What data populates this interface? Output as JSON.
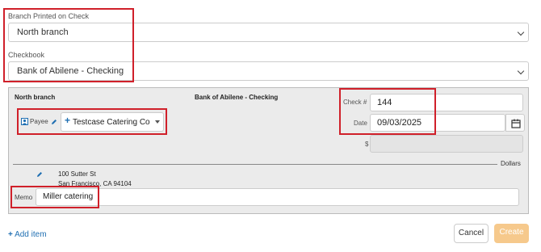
{
  "branch": {
    "label": "Branch Printed on Check",
    "value": "North branch"
  },
  "checkbook": {
    "label": "Checkbook",
    "value": "Bank of Abilene - Checking"
  },
  "check": {
    "branch_name": "North branch",
    "bank_name": "Bank of Abilene - Checking",
    "check_no_label": "Check #",
    "check_no": "144",
    "date_label": "Date",
    "date": "09/03/2025",
    "amount_symbol": "$",
    "amount": "",
    "payee_label": "Payee",
    "payee_value": "Testcase Catering Co",
    "dollars_label": "Dollars",
    "address_line1": "100 Sutter St",
    "address_line2": "San Francisco, CA 94104",
    "memo_label": "Memo",
    "memo_value": "Miller catering"
  },
  "actions": {
    "add_item": "Add item",
    "cancel": "Cancel",
    "create": "Create"
  },
  "colors": {
    "accent": "#1f6fb2",
    "highlight": "#d0202a",
    "create_bg": "#f6c98c"
  },
  "icons": [
    "chevron-down-icon",
    "person-icon",
    "pencil-icon",
    "plus-icon",
    "caret-down-icon",
    "calendar-icon"
  ]
}
